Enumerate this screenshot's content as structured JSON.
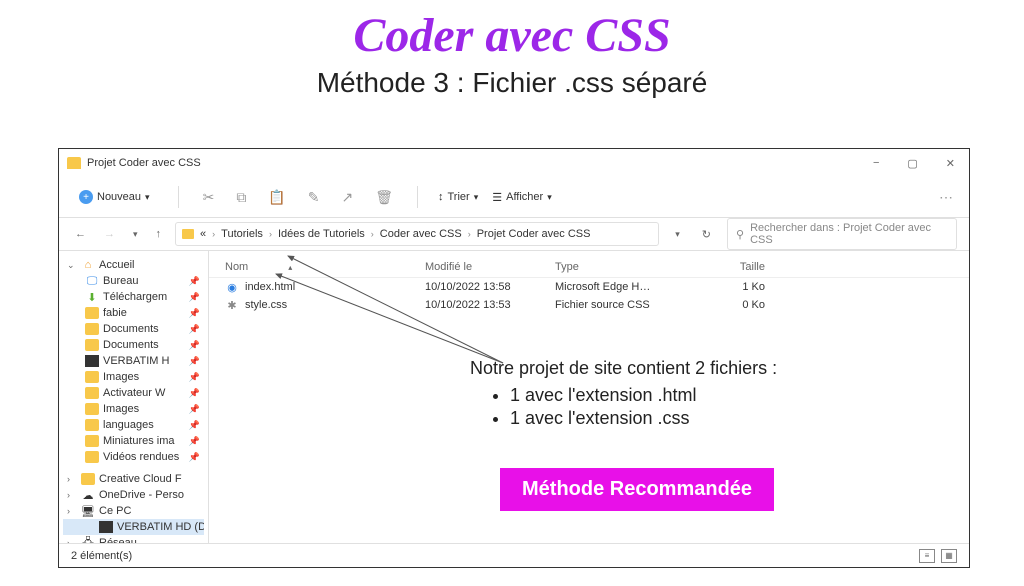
{
  "slide": {
    "title": "Coder avec CSS",
    "subtitle": "Méthode 3 : Fichier .css séparé",
    "annotation_intro": "Notre projet de site contient 2 fichiers :",
    "annotation_items": [
      "1 avec l'extension .html",
      "1 avec l'extension .css"
    ],
    "badge": "Méthode Recommandée"
  },
  "window": {
    "title": "Projet Coder avec CSS",
    "controls": {
      "min": "−",
      "max": "▢",
      "close": "✕"
    },
    "toolbar": {
      "new_label": "Nouveau",
      "sort_label": "Trier",
      "view_label": "Afficher"
    },
    "breadcrumb": [
      "«",
      "Tutoriels",
      "Idées de Tutoriels",
      "Coder avec CSS",
      "Projet Coder avec CSS"
    ],
    "search_placeholder": "Rechercher dans : Projet Coder avec CSS",
    "columns": {
      "name": "Nom",
      "date": "Modifié le",
      "type": "Type",
      "size": "Taille"
    },
    "files": [
      {
        "name": "index.html",
        "date": "10/10/2022 13:58",
        "type": "Microsoft Edge H…",
        "size": "1 Ko",
        "icon": "html"
      },
      {
        "name": "style.css",
        "date": "10/10/2022 13:53",
        "type": "Fichier source CSS",
        "size": "0 Ko",
        "icon": "css"
      }
    ],
    "statusbar": "2 élément(s)",
    "sidebar": {
      "home": "Accueil",
      "items": [
        {
          "label": "Bureau",
          "icon": "desktop"
        },
        {
          "label": "Téléchargem",
          "icon": "download"
        },
        {
          "label": "fabie",
          "icon": "folder"
        },
        {
          "label": "Documents",
          "icon": "folder"
        },
        {
          "label": "Documents",
          "icon": "folder"
        },
        {
          "label": "VERBATIM H",
          "icon": "dark"
        },
        {
          "label": "Images",
          "icon": "folder-blue"
        },
        {
          "label": "Activateur W",
          "icon": "folder"
        },
        {
          "label": "Images",
          "icon": "folder"
        },
        {
          "label": "languages",
          "icon": "folder"
        },
        {
          "label": "Miniatures ima",
          "icon": "folder"
        },
        {
          "label": "Vidéos rendues",
          "icon": "folder"
        }
      ],
      "groups": [
        {
          "label": "Creative Cloud F",
          "icon": "folder"
        },
        {
          "label": "OneDrive - Perso",
          "icon": "cloud"
        },
        {
          "label": "Ce PC",
          "icon": "pc"
        },
        {
          "label": "VERBATIM HD (D",
          "icon": "dark"
        },
        {
          "label": "Réseau",
          "icon": "net"
        }
      ]
    }
  }
}
